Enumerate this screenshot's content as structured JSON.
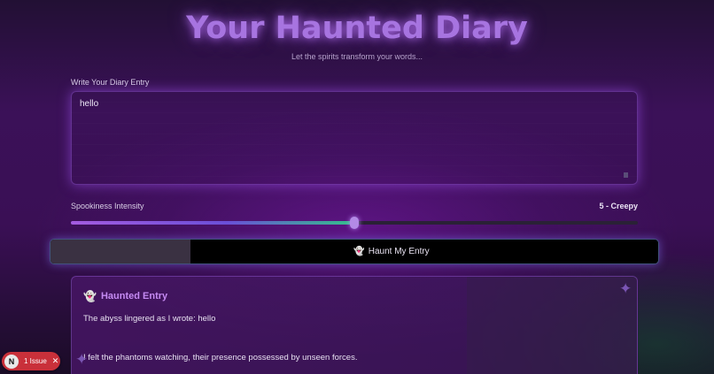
{
  "header": {
    "title": "Your Haunted Diary",
    "subtitle": "Let the spirits transform your words..."
  },
  "entry": {
    "label": "Write Your Diary Entry",
    "value": "hello"
  },
  "spookiness": {
    "label": "Spookiness Intensity",
    "value_text": "5 - Creepy",
    "level": 5,
    "max": 10
  },
  "haunt_button": {
    "icon": "ghost-icon",
    "icon_glyph": "👻",
    "label": "Haunt My Entry",
    "progress": 0.23
  },
  "result": {
    "icon": "ghost-icon",
    "icon_glyph": "👻",
    "title": "Haunted Entry",
    "line1": "The abyss lingered as I wrote: hello",
    "line2": "I felt the phantoms watching, their presence possessed by unseen forces."
  },
  "issue_badge": {
    "avatar_letter": "N",
    "text": "1 Issue",
    "close_glyph": "✕"
  },
  "colors": {
    "accent": "#a774e0",
    "result_title": "#c58af2",
    "issue_badge": "#c9303a"
  }
}
